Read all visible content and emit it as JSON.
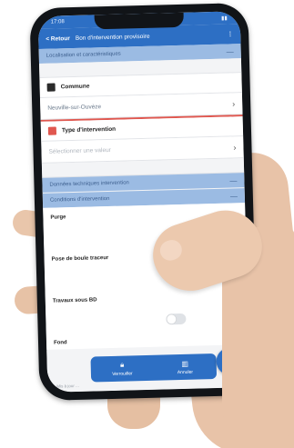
{
  "status_bar": {
    "time": "17:08"
  },
  "app_bar": {
    "back_label": "< Retour",
    "title": "Bon d'intervention provisoire",
    "more_label": "⋮"
  },
  "sections": {
    "location": "Localisation et caractéristiques",
    "intervention_data": "Données techniques intervention",
    "conditions": "Conditions d'intervention"
  },
  "commune": {
    "label": "Commune",
    "value": "Neuville-sur-Ouvèze"
  },
  "type_intervention": {
    "label": "Type d'intervention",
    "placeholder": "Sélectionner une valeur"
  },
  "fields": [
    {
      "label": "Purge"
    },
    {
      "label": "Pose de boule traceur"
    },
    {
      "label": "Travaux sous BD"
    },
    {
      "label": "Fond"
    }
  ],
  "bottom_bar": {
    "buttons": [
      {
        "label": "Verrouiller",
        "icon": "lock-icon"
      },
      {
        "label": "Annuler",
        "icon": "cancel-icon"
      }
    ],
    "fab_icon": "send-icon",
    "footer_note": "Mis à jour ..."
  },
  "colors": {
    "primary": "#2d6fc4",
    "section": "#9bbbe3",
    "accent_red": "#e0574f"
  }
}
